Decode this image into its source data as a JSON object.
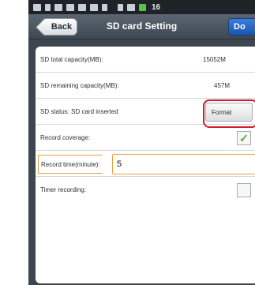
{
  "status_bar": {
    "time_fragment": "16"
  },
  "header": {
    "back_label": "Back",
    "title": "SD card Setting",
    "done_label": "Do"
  },
  "rows": {
    "total_capacity": {
      "label": "SD total capacity(MB):",
      "value": "15052M"
    },
    "remaining_capacity": {
      "label": "SD remaining capacity(MB):",
      "value": "457M"
    },
    "sd_status": {
      "label": "SD status: SD card inserted",
      "button_label": "Format"
    },
    "record_coverage": {
      "label": "Record coverage:",
      "checked": true
    },
    "record_time": {
      "label": "Record time(minute):",
      "value": "5"
    },
    "timer_recording": {
      "label": "Timer recording:",
      "checked": false
    }
  },
  "colors": {
    "highlight": "#d01e2a",
    "done_button": "#1b55b0",
    "check_mark": "#5aa832",
    "input_border": "#e4a53a"
  }
}
